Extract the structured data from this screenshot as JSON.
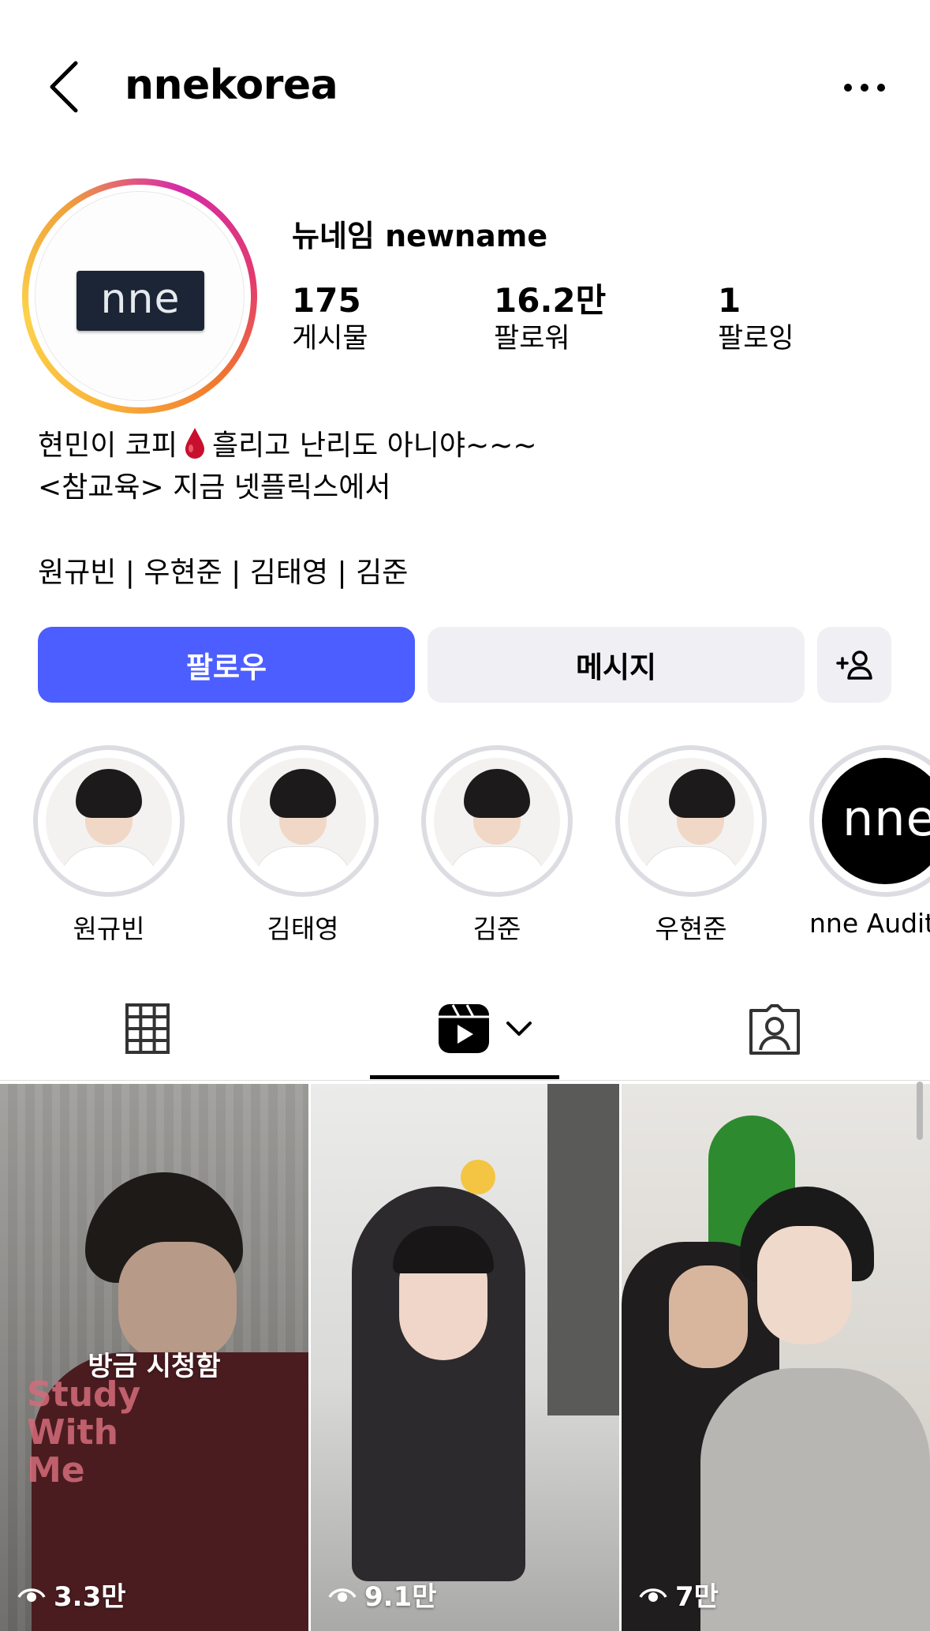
{
  "header": {
    "handle": "nnekorea"
  },
  "profile": {
    "display_name": "뉴네임 newname",
    "avatar_text": "nne",
    "stats": [
      {
        "value": "175",
        "label": "게시물"
      },
      {
        "value": "16.2만",
        "label": "팔로워"
      },
      {
        "value": "1",
        "label": "팔로잉"
      }
    ],
    "bio": {
      "line1_a": "현민이 코피",
      "line1_b": "흘리고 난리도 아니야~~~",
      "line2": "<참교육> 지금 넷플릭스에서",
      "line3": "원규빈 | 우현준 | 김태영 | 김준"
    }
  },
  "actions": {
    "follow_label": "팔로우",
    "message_label": "메시지"
  },
  "highlights": [
    {
      "label": "원규빈"
    },
    {
      "label": "김태영"
    },
    {
      "label": "김준"
    },
    {
      "label": "우현준"
    },
    {
      "label": "nne Audit",
      "logo_text": "nne"
    }
  ],
  "tabs": {
    "active": "reels"
  },
  "grid": [
    {
      "views": "3.3만",
      "overlay": "방금 시청함",
      "title_art": "Study With Me"
    },
    {
      "views": "9.1만"
    },
    {
      "views": "7만"
    }
  ],
  "colors": {
    "follow_button": "#4c5eff",
    "secondary_button": "#efeff4"
  }
}
